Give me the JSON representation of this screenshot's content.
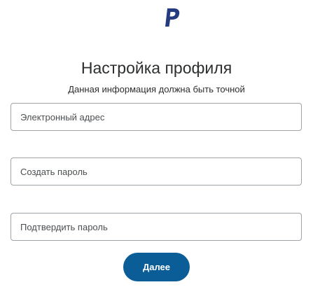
{
  "brand": {
    "logo_icon": "paypal-logo-icon",
    "color": "#253b80"
  },
  "header": {
    "title": "Настройка профиля",
    "subtitle": "Данная информация должна быть точной"
  },
  "form": {
    "email": {
      "placeholder": "Электронный адрес",
      "value": ""
    },
    "password": {
      "placeholder": "Создать пароль",
      "value": ""
    },
    "confirm_password": {
      "placeholder": "Подтвердить пароль",
      "value": ""
    },
    "submit_label": "Далее",
    "submit_color": "#0b5d98"
  }
}
